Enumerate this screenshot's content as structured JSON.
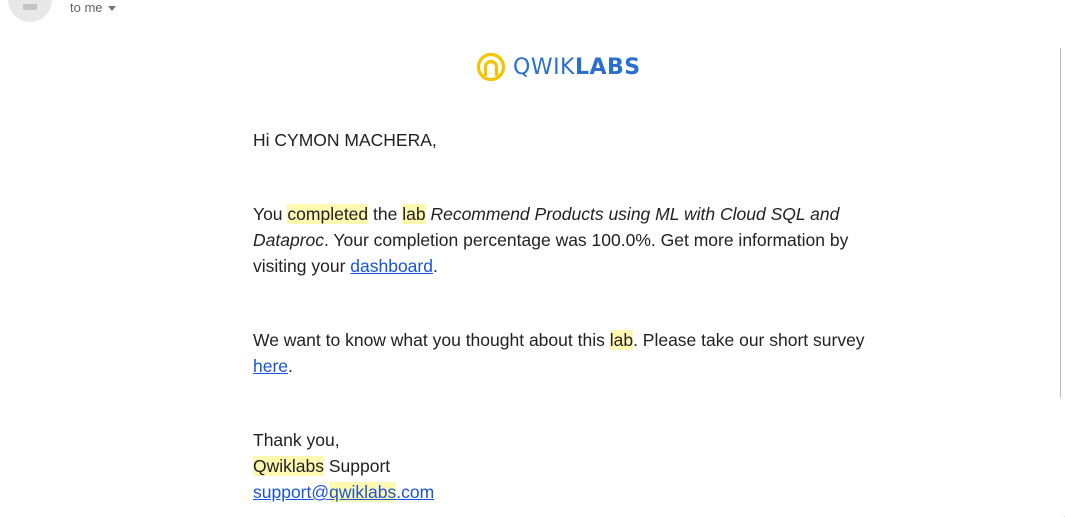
{
  "header": {
    "recipient_label": "to me"
  },
  "logo": {
    "text_light": "QWIK",
    "text_bold": "LABS",
    "brand_color": "#2a6fcf",
    "mark_color": "#f5c400"
  },
  "email": {
    "greeting": "Hi CYMON MACHERA,",
    "completion": {
      "part1": "You ",
      "completed": "completed",
      "part2": " the ",
      "lab": "lab",
      "part3": " ",
      "lab_title": "Recommend Products using ML with Cloud SQL and Dataproc",
      "part4": ". Your completion percentage was 100.0%. Get more information by visiting your ",
      "dashboard_link": "dashboard",
      "part5": "."
    },
    "survey": {
      "part1": "We want to know what you thought about this ",
      "lab": "lab",
      "part2": ". Please take our short survey ",
      "here_link": "here",
      "part3": "."
    },
    "signoff": {
      "thanks": "Thank you,",
      "team_highlight": "Qwiklabs",
      "team_rest": " Support",
      "email_prefix": "support@",
      "email_highlight": "qwiklabs",
      "email_suffix": ".com"
    }
  },
  "colors": {
    "highlight": "#fff8b0",
    "link": "#1a55d8",
    "text": "#222222"
  }
}
